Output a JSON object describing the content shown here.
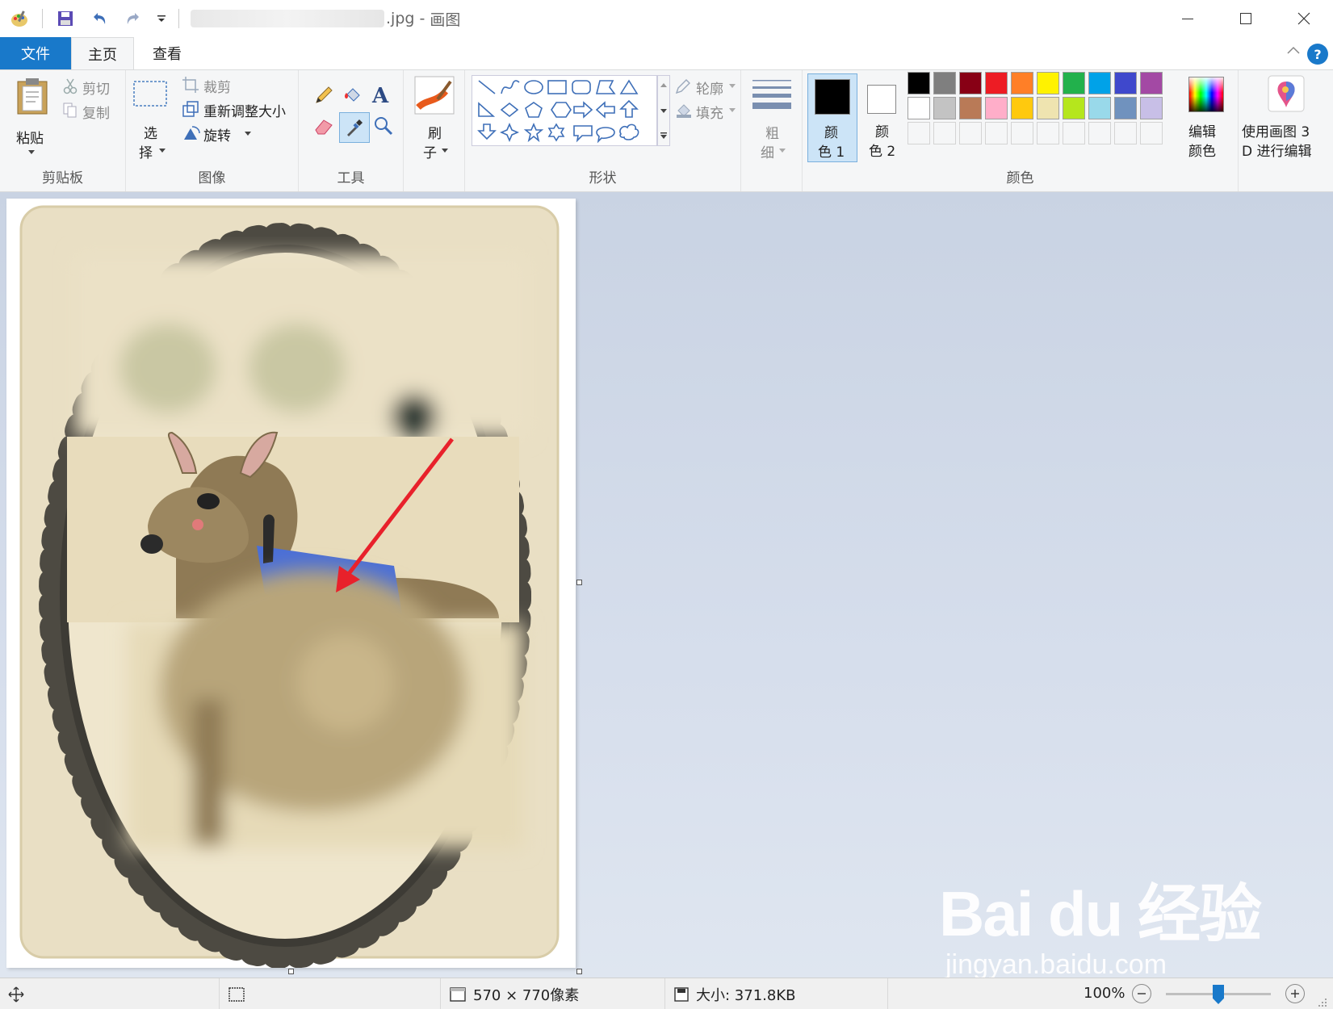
{
  "window": {
    "filename_suffix": ".jpg",
    "app_name": "画图",
    "title_separator": " - "
  },
  "tabs": {
    "file": "文件",
    "home": "主页",
    "view": "查看"
  },
  "clipboard": {
    "paste": "粘贴",
    "cut": "剪切",
    "copy": "复制",
    "group": "剪贴板"
  },
  "image": {
    "select_1": "选",
    "select_2": "择",
    "crop": "裁剪",
    "resize": "重新调整大小",
    "rotate": "旋转",
    "group": "图像"
  },
  "tools": {
    "group": "工具"
  },
  "brush": {
    "label_1": "刷",
    "label_2": "子"
  },
  "shapes": {
    "outline": "轮廓",
    "fill": "填充",
    "group": "形状"
  },
  "size": {
    "label_1": "粗",
    "label_2": "细"
  },
  "colors": {
    "color1_1": "颜",
    "color1_2": "色 1",
    "color2_1": "颜",
    "color2_2": "色 2",
    "edit_1": "编辑",
    "edit_2": "颜色",
    "paint3d_1": "使用画图 3",
    "paint3d_2": "D 进行编辑",
    "group": "颜色",
    "palette_row1": [
      "#000000",
      "#7f7f7f",
      "#880015",
      "#ed1c24",
      "#ff7f27",
      "#fff200",
      "#22b14c",
      "#00a2e8",
      "#3f48cc",
      "#a349a4"
    ],
    "palette_row2": [
      "#ffffff",
      "#c3c3c3",
      "#b97a57",
      "#ffaec9",
      "#ffc90e",
      "#efe4b0",
      "#b5e61d",
      "#99d9ea",
      "#7092be",
      "#c8bfe7"
    ],
    "primary": "#000000",
    "secondary": "#ffffff"
  },
  "status": {
    "dimensions": "570 × 770像素",
    "size": "大小: 371.8KB",
    "zoom": "100%",
    "zoom_fraction": 0.5
  },
  "watermark": {
    "brand": "Bai du 经验",
    "url": "jingyan.baidu.com"
  }
}
